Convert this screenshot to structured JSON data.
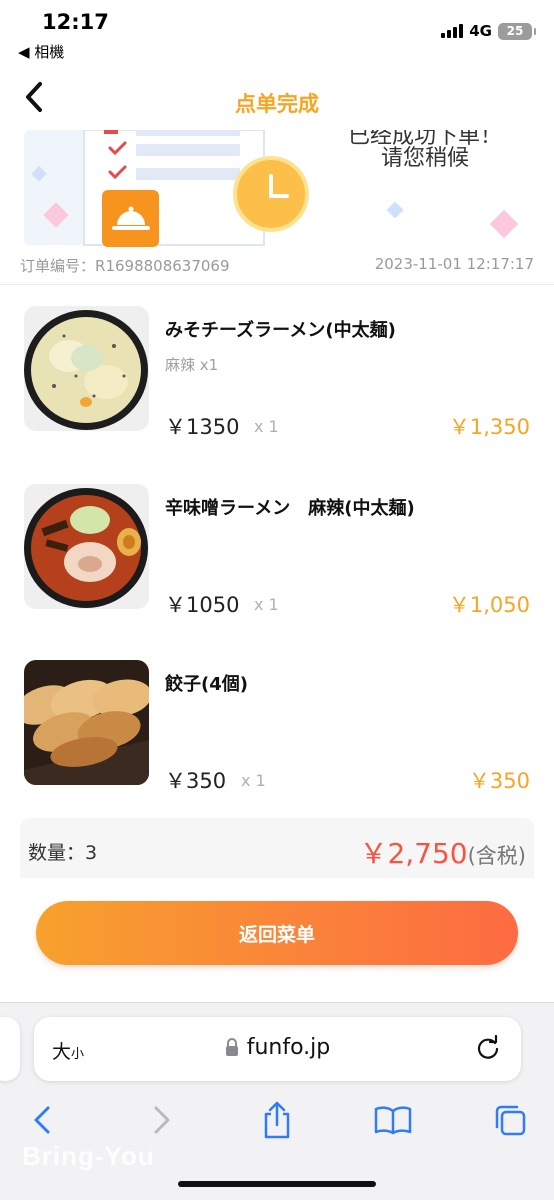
{
  "status_bar": {
    "time": "12:17",
    "back_app": "◀ 相機",
    "network": "4G",
    "battery": "25"
  },
  "nav": {
    "title": "点单完成"
  },
  "banner": {
    "cut_text": "已经成功下单！",
    "message": "请您稍候"
  },
  "order": {
    "number_label": "订单编号：",
    "number": "R1698808637069",
    "datetime": "2023-11-01 12:17:17"
  },
  "items": [
    {
      "name": "みそチーズラーメン(中太麺)",
      "option": "麻辣 x1",
      "price": "￥1350",
      "qty": "x 1",
      "total": "￥1,350"
    },
    {
      "name": "辛味噌ラーメン　麻辣(中太麺)",
      "option": "",
      "price": "￥1050",
      "qty": "x 1",
      "total": "￥1,050"
    },
    {
      "name": "餃子(4個)",
      "option": "",
      "price": "￥350",
      "qty": "x 1",
      "total": "￥350"
    }
  ],
  "summary": {
    "qty_label": "数量：",
    "qty": "3",
    "total": "￥2,750",
    "tax_note": "(含税)"
  },
  "buttons": {
    "return": "返回菜单"
  },
  "browser": {
    "text_size": "大",
    "text_size_small": "小",
    "url": "funfo.jp"
  },
  "watermark": "Bring-You",
  "colors": {
    "accent": "#f6a623",
    "total_red": "#f9543f",
    "button_start": "#f7a12e",
    "button_end": "#fd6b42"
  },
  "icons": [
    "back-chevron-icon",
    "lock-icon",
    "reload-icon",
    "safari-back-icon",
    "safari-forward-icon",
    "share-icon",
    "bookmarks-icon",
    "tabs-icon"
  ]
}
